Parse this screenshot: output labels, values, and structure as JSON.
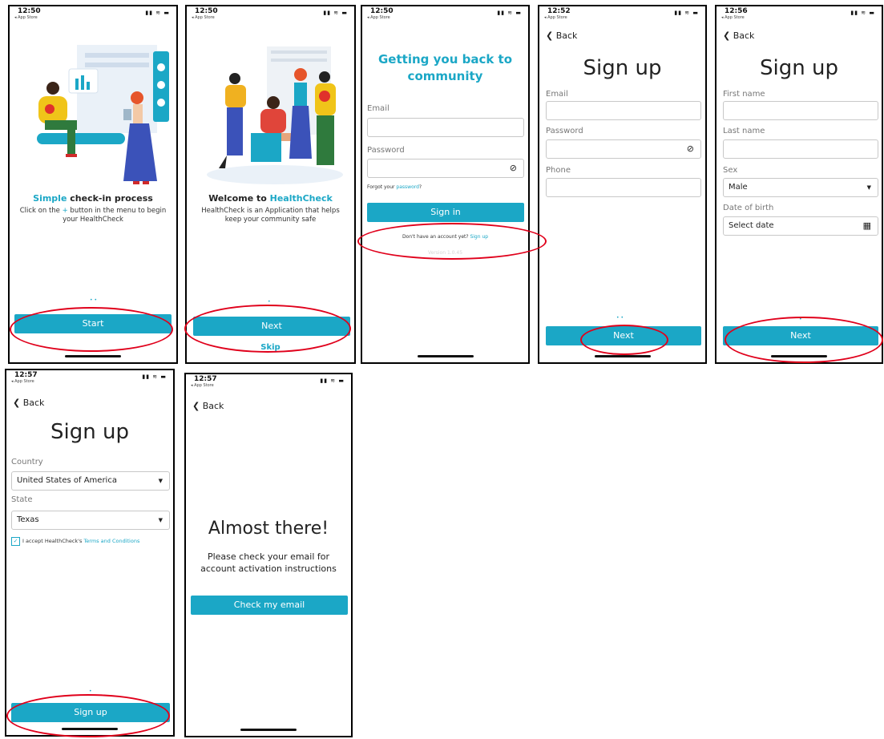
{
  "status": {
    "store": "◂ App Store",
    "icons": "▮▮ ≋ ▬",
    "times": [
      "12:50",
      "12:50",
      "12:50",
      "12:52",
      "12:56",
      "12:57",
      "12:57"
    ]
  },
  "screen1": {
    "title_accent": "Simple",
    "title_rest": " check-in process",
    "desc_part1": "Click on the ",
    "desc_plus": "+",
    "desc_part2": " button in the menu to begin your HealthCheck",
    "dots": "• •",
    "start_label": "Start"
  },
  "screen2": {
    "title_part1": "Welcome to ",
    "title_accent": "HealthCheck",
    "desc": "HealthCheck is an Application that helps keep your community safe",
    "dots": "•",
    "next_label": "Next",
    "skip_label": "Skip"
  },
  "screen3": {
    "heading": "Getting you back to community",
    "email_label": "Email",
    "password_label": "Password",
    "forgot_part1": "Forgot your ",
    "forgot_link": "password",
    "forgot_part2": "?",
    "signin_label": "Sign in",
    "no_account": "Don't have an account yet? ",
    "signup_link": "Sign up",
    "version": "Version 1.0.45"
  },
  "screen4": {
    "back": "Back",
    "title": "Sign up",
    "email_label": "Email",
    "password_label": "Password",
    "phone_label": "Phone",
    "dots": "• •",
    "next_label": "Next"
  },
  "screen5": {
    "back": "Back",
    "title": "Sign up",
    "firstname_label": "First name",
    "lastname_label": "Last name",
    "sex_label": "Sex",
    "sex_value": "Male",
    "dob_label": "Date of birth",
    "dob_placeholder": "Select date",
    "dots": "•",
    "next_label": "Next"
  },
  "screen6": {
    "back": "Back",
    "title": "Sign up",
    "country_label": "Country",
    "country_value": "United States of America",
    "state_label": "State",
    "state_value": "Texas",
    "accept_part1": "I accept HealthCheck's ",
    "accept_link": "Terms and Conditions",
    "dots": "•",
    "signup_label": "Sign up"
  },
  "screen7": {
    "back": "Back",
    "title": "Almost there!",
    "desc": "Please check your email for account activation instructions",
    "check_label": "Check my email"
  },
  "colors": {
    "accent": "#1ba7c6",
    "annotation": "#e0001b"
  }
}
